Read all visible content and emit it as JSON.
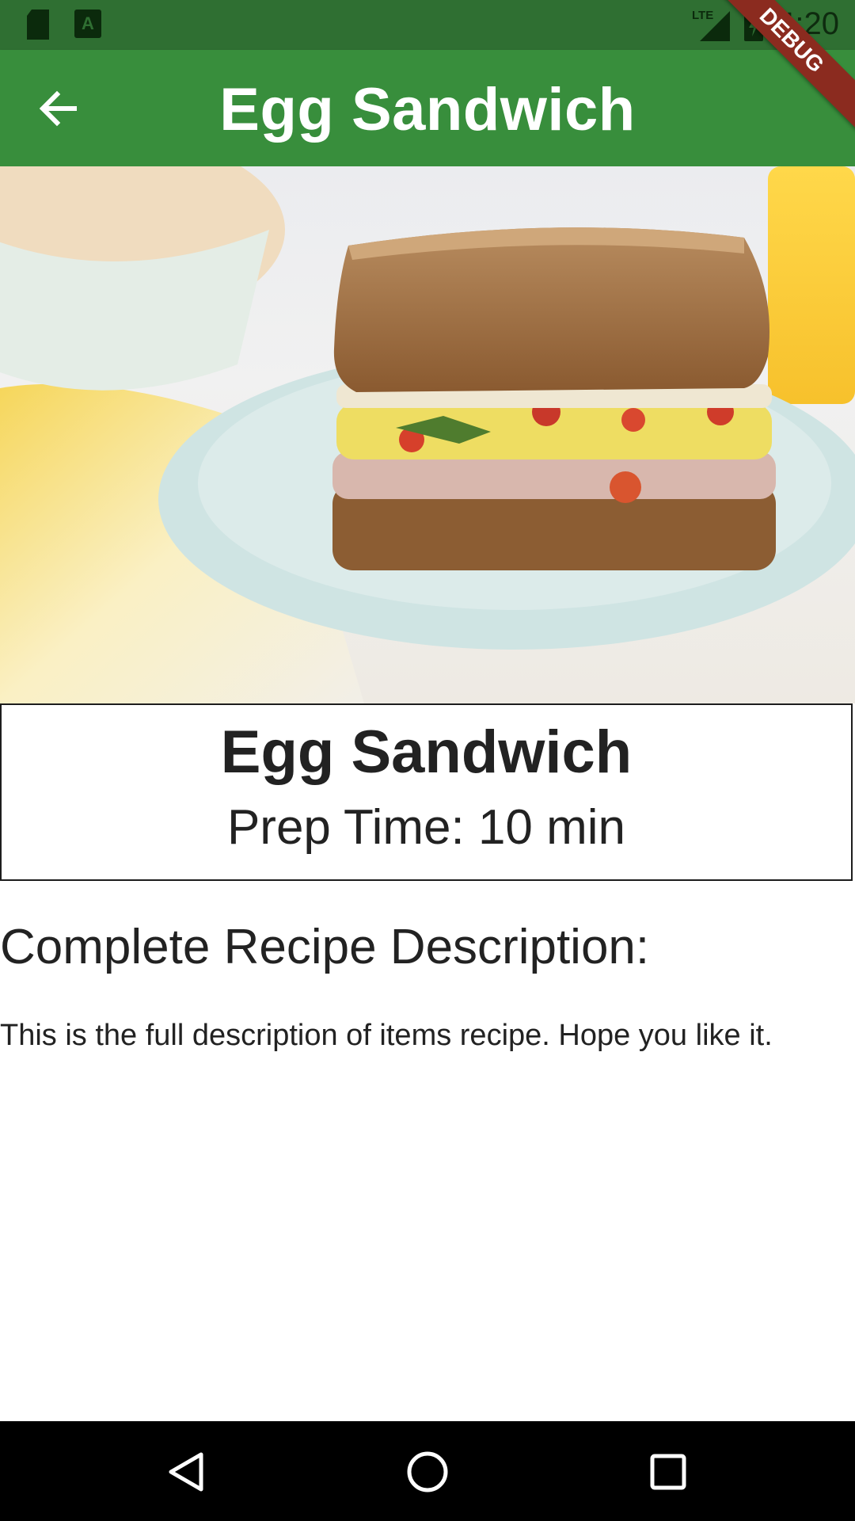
{
  "status_bar": {
    "time": "4:20",
    "network": "LTE",
    "icons": [
      "sd-card-icon",
      "a-notification-icon",
      "lte-signal-icon",
      "battery-charging-icon"
    ]
  },
  "app_bar": {
    "title": "Egg Sandwich",
    "back_icon": "arrow-back-icon",
    "debug_label": "DEBUG"
  },
  "recipe": {
    "name": "Egg Sandwich",
    "prep_time": "Prep Time: 10 min",
    "description_heading": "Complete Recipe Description:",
    "description": "This is the full description of items recipe. Hope you like it."
  },
  "nav_bar": {
    "icons": [
      "back-triangle-icon",
      "home-circle-icon",
      "recents-square-icon"
    ]
  },
  "colors": {
    "app_bar": "#388e3c",
    "status_bar": "#2f6f32",
    "debug_ribbon": "#8b2b1f"
  }
}
